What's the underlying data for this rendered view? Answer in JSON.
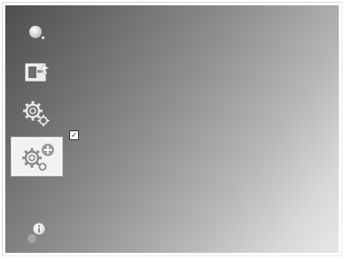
{
  "sidebar": {
    "items": [
      {
        "name": "home",
        "icon": "circle-dot-icon",
        "selected": false
      },
      {
        "name": "display-settings",
        "icon": "screen-arrow-icon",
        "selected": false
      },
      {
        "name": "settings",
        "icon": "gear-icon",
        "selected": false
      },
      {
        "name": "advanced-settings",
        "icon": "gear-plus-icon",
        "selected": true,
        "checked": true
      },
      {
        "name": "info",
        "icon": "info-icon",
        "selected": false
      }
    ]
  },
  "check_mark": "✓",
  "colors": {
    "panel_dark": "#4e4e4e",
    "panel_light": "#e8e8e8",
    "selected_bg": "#f2f2f2",
    "icon_light": "#e6e6e6"
  }
}
